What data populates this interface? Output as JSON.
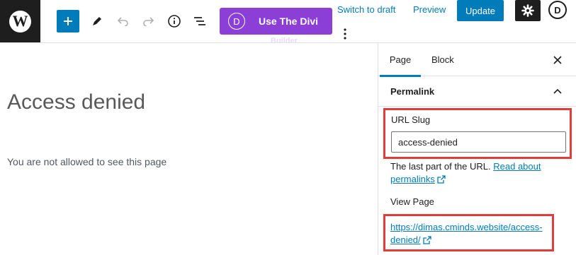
{
  "toolbar": {
    "divi_button_label": "Use The Divi",
    "divi_button_overflow": "Builder",
    "switch_to_draft": "Switch to draft",
    "preview": "Preview",
    "update": "Update",
    "divi_icon_letter": "D"
  },
  "icons": {
    "wp_logo": "wordpress-logo-icon",
    "inserter": "plus-icon",
    "tools": "pencil-icon",
    "undo": "undo-icon",
    "redo": "redo-icon",
    "details": "info-icon",
    "outline": "list-view-icon",
    "more": "vertical-ellipsis-icon",
    "settings": "gear-icon",
    "close": "close-icon",
    "collapse": "chevron-up-icon",
    "external": "external-link-icon"
  },
  "editor": {
    "title": "Access denied",
    "paragraph": "You are not allowed to see this page"
  },
  "sidebar": {
    "tabs": [
      {
        "label": "Page",
        "active": true
      },
      {
        "label": "Block",
        "active": false
      }
    ],
    "panel_title": "Permalink",
    "url_slug_label": "URL Slug",
    "url_slug_value": "access-denied",
    "help_text": "The last part of the URL.",
    "help_link": "Read about permalinks",
    "view_page_label": "View Page",
    "view_page_url": "https://dimas.cminds.website/access-denied/"
  },
  "colors": {
    "accent": "#007cba",
    "divi_purple": "#8c3fd6",
    "highlight_red": "#e23d3d",
    "dark": "#1e1e1e"
  }
}
